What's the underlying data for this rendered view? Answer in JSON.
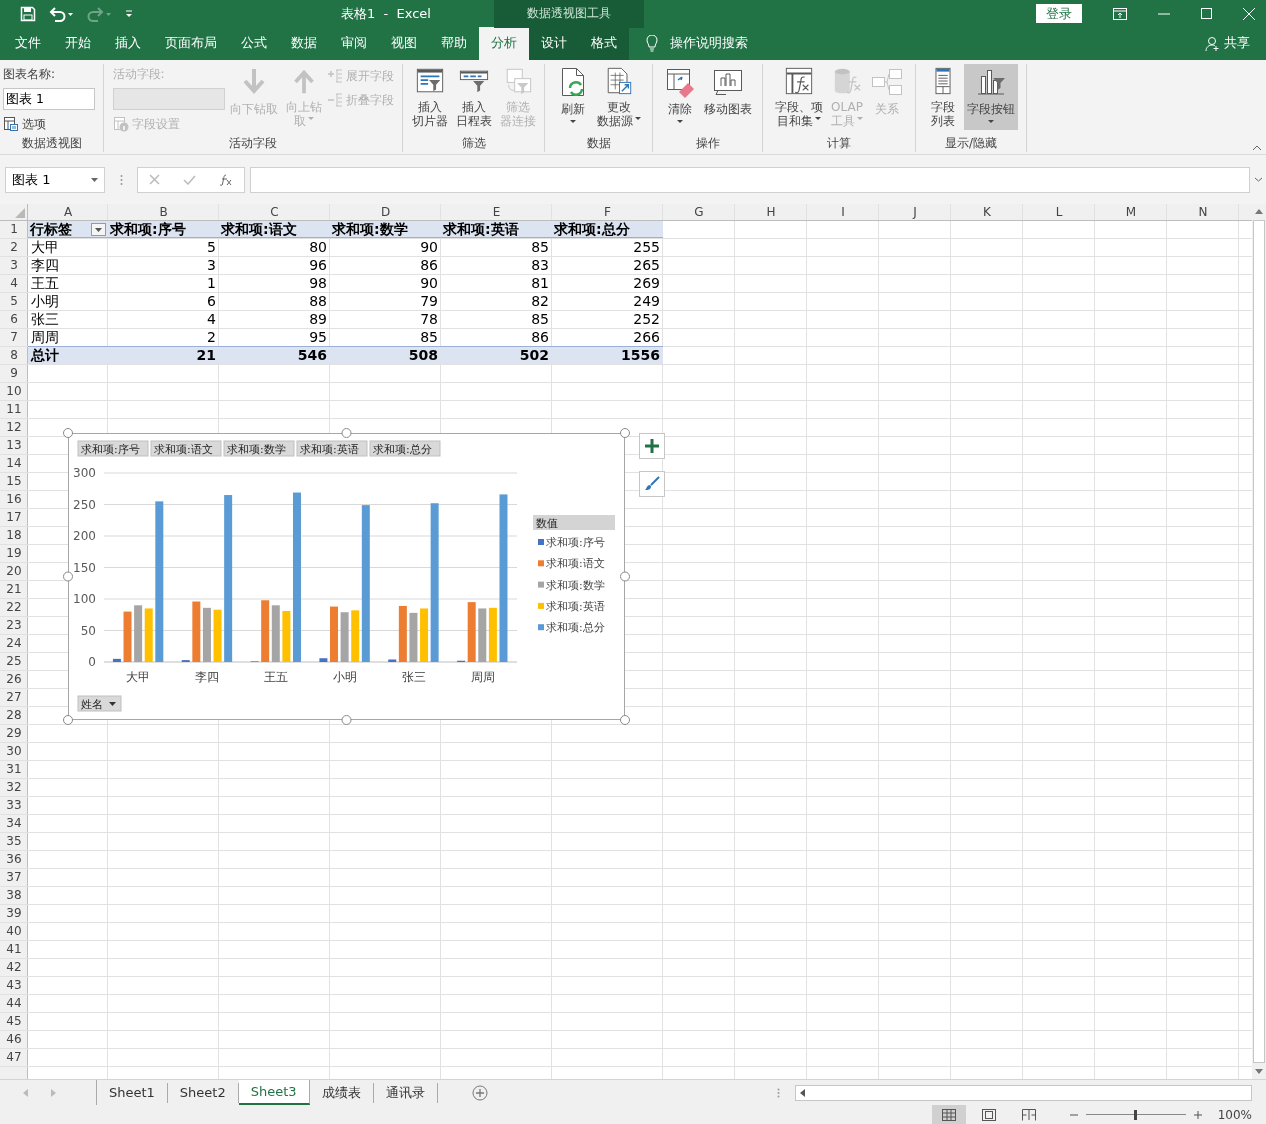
{
  "title_bar": {
    "quick_access": [
      {
        "disabled": false
      },
      {
        "disabled": false
      },
      {
        "disabled": true
      },
      {
        "disabled": false
      }
    ],
    "title": "表格1  -  Excel",
    "context_title": "数据透视图工具",
    "login": "登录"
  },
  "tabs": [
    {
      "label": "文件",
      "selected": false,
      "contextual": false
    },
    {
      "label": "开始",
      "selected": false,
      "contextual": false
    },
    {
      "label": "插入",
      "selected": false,
      "contextual": false
    },
    {
      "label": "页面布局",
      "selected": false,
      "contextual": false
    },
    {
      "label": "公式",
      "selected": false,
      "contextual": false
    },
    {
      "label": "数据",
      "selected": false,
      "contextual": false
    },
    {
      "label": "审阅",
      "selected": false,
      "contextual": false
    },
    {
      "label": "视图",
      "selected": false,
      "contextual": false
    },
    {
      "label": "帮助",
      "selected": false,
      "contextual": false
    },
    {
      "label": "分析",
      "selected": true,
      "contextual": true
    },
    {
      "label": "设计",
      "selected": false,
      "contextual": true
    },
    {
      "label": "格式",
      "selected": false,
      "contextual": true
    }
  ],
  "tell_me": "操作说明搜索",
  "share": "共享",
  "ribbon": [
    {
      "label": "数据透视图",
      "columns": [
        [
          {
            "kind": "label",
            "label": "图表名称:",
            "disabled": false
          },
          {
            "kind": "input",
            "value": "图表 1",
            "disabled": false
          },
          {
            "kind": "small",
            "label": "选项",
            "disabled": false
          }
        ]
      ]
    },
    {
      "label": "活动字段",
      "columns": [
        [
          {
            "kind": "label",
            "label": "活动字段:",
            "disabled": true
          },
          {
            "kind": "input",
            "disabled": true
          },
          {
            "kind": "small",
            "label": "字段设置",
            "disabled": true
          }
        ],
        [
          {
            "kind": "large",
            "lines": [
              "向下钻取"
            ],
            "disabled": true,
            "dropdown": false
          }
        ],
        [
          {
            "kind": "large",
            "lines": [
              "向上钻",
              "取"
            ],
            "disabled": true,
            "dropdown": true
          }
        ],
        [
          {
            "kind": "small",
            "label": "展开字段",
            "disabled": true
          },
          {
            "kind": "small",
            "label": "折叠字段",
            "disabled": true
          }
        ]
      ]
    },
    {
      "label": "筛选",
      "columns": [
        [
          {
            "kind": "large",
            "lines": [
              "插入",
              "切片器"
            ],
            "disabled": false,
            "dropdown": false
          }
        ],
        [
          {
            "kind": "large",
            "lines": [
              "插入",
              "日程表"
            ],
            "disabled": false,
            "dropdown": false
          }
        ],
        [
          {
            "kind": "large",
            "lines": [
              "筛选",
              "器连接"
            ],
            "disabled": true,
            "dropdown": false
          }
        ]
      ]
    },
    {
      "label": "数据",
      "columns": [
        [
          {
            "kind": "large",
            "lines": [
              "刷新"
            ],
            "disabled": false,
            "dropdown": true
          }
        ],
        [
          {
            "kind": "large",
            "lines": [
              "更改",
              "数据源"
            ],
            "disabled": false,
            "dropdown": true
          }
        ]
      ]
    },
    {
      "label": "操作",
      "columns": [
        [
          {
            "kind": "large",
            "lines": [
              "清除"
            ],
            "disabled": false,
            "dropdown": true
          }
        ],
        [
          {
            "kind": "large",
            "lines": [
              "移动图表"
            ],
            "disabled": false,
            "dropdown": false
          }
        ]
      ]
    },
    {
      "label": "计算",
      "columns": [
        [
          {
            "kind": "large",
            "lines": [
              "字段、项",
              "目和集"
            ],
            "disabled": false,
            "dropdown": true
          }
        ],
        [
          {
            "kind": "large",
            "lines": [
              "OLAP",
              "工具"
            ],
            "disabled": true,
            "dropdown": true
          }
        ],
        [
          {
            "kind": "large",
            "lines": [
              "关系"
            ],
            "disabled": true,
            "dropdown": false
          }
        ]
      ]
    },
    {
      "label": "显示/隐藏",
      "columns": [
        [
          {
            "kind": "large",
            "lines": [
              "字段",
              "列表"
            ],
            "disabled": false,
            "dropdown": false,
            "selected": false
          }
        ],
        [
          {
            "kind": "large",
            "lines": [
              "字段按钮"
            ],
            "disabled": false,
            "dropdown": true,
            "selected": true
          }
        ]
      ]
    }
  ],
  "formula_bar": {
    "name_box": "图表 1"
  },
  "sheet": {
    "columns": [
      "A",
      "B",
      "C",
      "D",
      "E",
      "F",
      "G",
      "H",
      "I",
      "J",
      "K",
      "L",
      "M",
      "N"
    ],
    "rows": [
      {
        "number": "1",
        "kind": "header",
        "cells": [
          "行标签",
          "求和项:序号",
          "求和项:语文",
          "求和项:数学",
          "求和项:英语",
          "求和项:总分"
        ]
      },
      {
        "number": "2",
        "kind": "data",
        "cells": [
          "大甲",
          "5",
          "80",
          "90",
          "85",
          "255"
        ]
      },
      {
        "number": "3",
        "kind": "data",
        "cells": [
          "李四",
          "3",
          "96",
          "86",
          "83",
          "265"
        ]
      },
      {
        "number": "4",
        "kind": "data",
        "cells": [
          "王五",
          "1",
          "98",
          "90",
          "81",
          "269"
        ]
      },
      {
        "number": "5",
        "kind": "data",
        "cells": [
          "小明",
          "6",
          "88",
          "79",
          "82",
          "249"
        ]
      },
      {
        "number": "6",
        "kind": "data",
        "cells": [
          "张三",
          "4",
          "89",
          "78",
          "85",
          "252"
        ]
      },
      {
        "number": "7",
        "kind": "data",
        "cells": [
          "周周",
          "2",
          "95",
          "85",
          "86",
          "266"
        ]
      },
      {
        "number": "8",
        "kind": "total",
        "cells": [
          "总计",
          "21",
          "546",
          "508",
          "502",
          "1556"
        ]
      },
      {
        "number": "9"
      },
      {
        "number": "10"
      },
      {
        "number": "11"
      },
      {
        "number": "12"
      },
      {
        "number": "13"
      },
      {
        "number": "14"
      },
      {
        "number": "15"
      },
      {
        "number": "16"
      },
      {
        "number": "17"
      },
      {
        "number": "18"
      },
      {
        "number": "19"
      },
      {
        "number": "20"
      },
      {
        "number": "21"
      },
      {
        "number": "22"
      },
      {
        "number": "23"
      },
      {
        "number": "24"
      },
      {
        "number": "25"
      },
      {
        "number": "26"
      },
      {
        "number": "27"
      },
      {
        "number": "28"
      },
      {
        "number": "29"
      },
      {
        "number": "30"
      },
      {
        "number": "31"
      },
      {
        "number": "32"
      },
      {
        "number": "33"
      },
      {
        "number": "34"
      },
      {
        "number": "35"
      },
      {
        "number": "36"
      },
      {
        "number": "37"
      },
      {
        "number": "38"
      },
      {
        "number": "39"
      },
      {
        "number": "40"
      },
      {
        "number": "41"
      },
      {
        "number": "42"
      },
      {
        "number": "43"
      },
      {
        "number": "44"
      },
      {
        "number": "45"
      },
      {
        "number": "46"
      },
      {
        "number": "47"
      }
    ]
  },
  "chart": {
    "value_buttons": [
      "求和项:序号",
      "求和项:语文",
      "求和项:数学",
      "求和项:英语",
      "求和项:总分"
    ],
    "axis_button": "姓名",
    "legend_title": "数值",
    "chart_data": {
      "type": "bar",
      "grid": true,
      "legend": true,
      "categories": [
        "大甲",
        "李四",
        "王五",
        "小明",
        "张三",
        "周周"
      ],
      "ylim": [
        0,
        300
      ],
      "yticks": [
        0,
        50,
        100,
        150,
        200,
        250,
        300
      ],
      "series": [
        {
          "name": "求和项:序号",
          "color": "#4472c4",
          "values": [
            5,
            3,
            1,
            6,
            4,
            2
          ]
        },
        {
          "name": "求和项:语文",
          "color": "#ed7d31",
          "values": [
            80,
            96,
            98,
            88,
            89,
            95
          ]
        },
        {
          "name": "求和项:数学",
          "color": "#a5a5a5",
          "values": [
            90,
            86,
            90,
            79,
            78,
            85
          ]
        },
        {
          "name": "求和项:英语",
          "color": "#ffc000",
          "values": [
            85,
            83,
            81,
            82,
            85,
            86
          ]
        },
        {
          "name": "求和项:总分",
          "color": "#5b9bd5",
          "values": [
            255,
            265,
            269,
            249,
            252,
            266
          ]
        }
      ]
    }
  },
  "sheet_tabs": [
    {
      "label": "Sheet1",
      "selected": false
    },
    {
      "label": "Sheet2",
      "selected": false
    },
    {
      "label": "Sheet3",
      "selected": true
    },
    {
      "label": "成绩表",
      "selected": false
    },
    {
      "label": "通讯录",
      "selected": false
    }
  ],
  "status_bar": {
    "views": [
      {
        "selected": true
      },
      {
        "selected": false
      },
      {
        "selected": false
      }
    ],
    "zoom": {
      "level": 0.5
    },
    "zoom_text": "100%"
  }
}
